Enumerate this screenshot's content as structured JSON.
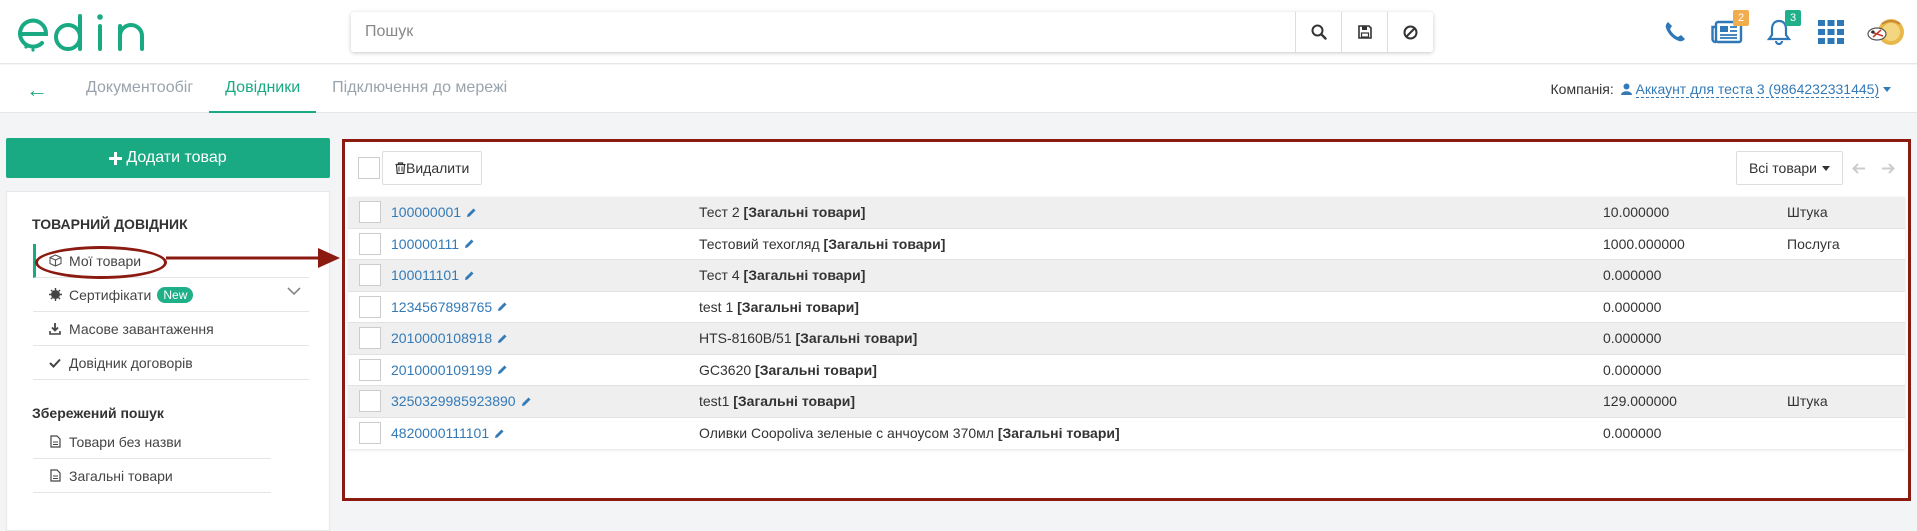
{
  "brand": {
    "logo_text": "edin",
    "accent": "#1aaa83",
    "link": "#337ab7",
    "annotation": "#8b1a10"
  },
  "search": {
    "placeholder": "Пошук"
  },
  "header_icons": {
    "phone": "phone-icon",
    "news": "newspaper-icon",
    "news_badge": "2",
    "bell": "bell-icon",
    "bell_badge": "3",
    "apps": "grid-icon",
    "avatar": "avatar"
  },
  "nav": {
    "back": "←",
    "tabs": [
      "Документообіг",
      "Довідники",
      "Підключення до мережі"
    ],
    "active_tab": "Довідники",
    "company_label": "Компанія:",
    "company_value": "Аккаунт для теста 3 (9864232331445)"
  },
  "sidebar": {
    "add_button": "Додати товар",
    "section_title": "ТОВАРНИЙ ДОВІДНИК",
    "items": [
      {
        "label": "Мої товари",
        "icon": "cube-icon"
      },
      {
        "label": "Сертифікати",
        "icon": "certificate-icon",
        "badge": "New"
      },
      {
        "label": "Масове завантаження",
        "icon": "download-icon"
      },
      {
        "label": "Довідник договорів",
        "icon": "check-icon"
      }
    ],
    "saved_title": "Збережений пошук",
    "saved_items": [
      {
        "label": "Товари без назви",
        "icon": "file-icon"
      },
      {
        "label": "Загальні товари",
        "icon": "file-icon"
      }
    ]
  },
  "main": {
    "delete_button": "Видалити",
    "filter_button": "Всі товари",
    "rows": [
      {
        "code": "100000001",
        "name": "Тест 2",
        "group": "[Загальні товари]",
        "qty": "10.000000",
        "unit": "Штука"
      },
      {
        "code": "100000111",
        "name": "Тестовий техогляд",
        "group": "[Загальні товари]",
        "qty": "1000.000000",
        "unit": "Послуга"
      },
      {
        "code": "100011101",
        "name": "Тест 4",
        "group": "[Загальні товари]",
        "qty": "0.000000",
        "unit": ""
      },
      {
        "code": "1234567898765",
        "name": "test 1",
        "group": "[Загальні товари]",
        "qty": "0.000000",
        "unit": ""
      },
      {
        "code": "2010000108918",
        "name": "HTS-8160B/51",
        "group": "[Загальні товари]",
        "qty": "0.000000",
        "unit": ""
      },
      {
        "code": "2010000109199",
        "name": "GC3620",
        "group": "[Загальні товари]",
        "qty": "0.000000",
        "unit": ""
      },
      {
        "code": "3250329985923890",
        "name": "test1",
        "group": "[Загальні товари]",
        "qty": "129.000000",
        "unit": "Штука"
      },
      {
        "code": "4820000111101",
        "name": "Оливки Coopoliva зеленые с анчоусом 370мл",
        "group": "[Загальні товари]",
        "qty": "0.000000",
        "unit": ""
      }
    ]
  }
}
